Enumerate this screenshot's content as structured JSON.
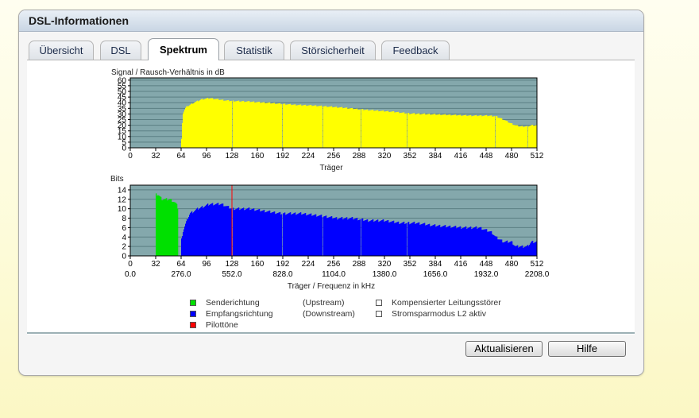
{
  "window": {
    "title": "DSL-Informationen"
  },
  "tabs": [
    {
      "label": "Übersicht"
    },
    {
      "label": "DSL"
    },
    {
      "label": "Spektrum",
      "active": true
    },
    {
      "label": "Statistik"
    },
    {
      "label": "Störsicherheit"
    },
    {
      "label": "Feedback"
    }
  ],
  "colors": {
    "plot_bg": "#84a8ac",
    "snr_fill": "#ffff00",
    "upstream": "#00e000",
    "downstream": "#0000ff",
    "pilot": "#ff0000",
    "gridline": "#5b7f83"
  },
  "chart_data": [
    {
      "type": "bar",
      "title": "Signal / Rausch-Verhältnis in dB",
      "xlabel": "Träger",
      "xlim": [
        0,
        512
      ],
      "ylim": [
        0,
        62
      ],
      "x_ticks": [
        "0",
        "32",
        "64",
        "96",
        "128",
        "160",
        "192",
        "224",
        "256",
        "288",
        "320",
        "352",
        "384",
        "416",
        "448",
        "480",
        "512"
      ],
      "y_ticks": [
        "0",
        "5",
        "10",
        "15",
        "20",
        "25",
        "30",
        "35",
        "40",
        "45",
        "50",
        "55",
        "60"
      ],
      "series": [
        {
          "color": "#ffff00",
          "x": [
            64,
            66,
            70,
            75,
            80,
            90,
            100,
            110,
            120,
            130,
            150,
            170,
            190,
            210,
            230,
            250,
            270,
            290,
            310,
            330,
            350,
            370,
            390,
            410,
            430,
            450,
            460,
            470,
            478,
            485,
            490,
            500,
            505,
            512
          ],
          "values": [
            0,
            30,
            36,
            38,
            40,
            43,
            44,
            43,
            42,
            41.5,
            41,
            40,
            39,
            38,
            37.5,
            36.5,
            35.5,
            34,
            33,
            32,
            30.5,
            30,
            29.5,
            29,
            28.5,
            28.5,
            28,
            25,
            22,
            20,
            19,
            19,
            20,
            20
          ]
        }
      ],
      "gaps": [
        128,
        191,
        242,
        290,
        348,
        459,
        500
      ]
    },
    {
      "type": "bar",
      "ylabel": "Bits",
      "xlabel": "Träger / Frequenz in kHz",
      "xlim": [
        0,
        512
      ],
      "ylim": [
        0,
        15
      ],
      "x_ticks": [
        "0",
        "32",
        "64",
        "96",
        "128",
        "160",
        "192",
        "224",
        "256",
        "288",
        "320",
        "352",
        "384",
        "416",
        "448",
        "480",
        "512"
      ],
      "freq_ticks": [
        "0.0",
        "276.0",
        "552.0",
        "828.0",
        "1104.0",
        "1380.0",
        "1656.0",
        "1932.0",
        "2208.0"
      ],
      "y_ticks": [
        "0",
        "2",
        "4",
        "6",
        "8",
        "10",
        "12",
        "14"
      ],
      "series": [
        {
          "name": "Upstream",
          "color": "#00e000",
          "x": [
            32,
            35,
            40,
            45,
            50,
            55,
            58,
            60
          ],
          "values": [
            13,
            13,
            12,
            12,
            12,
            11.5,
            11,
            10
          ]
        },
        {
          "name": "Downstream",
          "color": "#0000ff",
          "x": [
            64,
            66,
            70,
            75,
            85,
            100,
            115,
            128,
            135,
            150,
            170,
            190,
            215,
            240,
            260,
            280,
            300,
            320,
            340,
            360,
            380,
            420,
            440,
            455,
            460,
            470,
            480,
            485,
            490,
            500,
            505,
            512
          ],
          "values": [
            3,
            5,
            7,
            9,
            10,
            11,
            11,
            10,
            10,
            10,
            9.5,
            9,
            9,
            8.5,
            8,
            8,
            7.5,
            7.5,
            7,
            7,
            6.5,
            6,
            6,
            5,
            4,
            3,
            3,
            2,
            2,
            2,
            3,
            3
          ]
        }
      ],
      "pilot_tones": [
        128
      ],
      "gaps": [
        128,
        191,
        242,
        290,
        348
      ]
    }
  ],
  "legend": {
    "upstream_label": "Senderichtung",
    "upstream_note": "(Upstream)",
    "downstream_label": "Empfangsrichtung",
    "downstream_note": "(Downstream)",
    "pilot_label": "Pilottöne",
    "crosstalk_label": "Kompensierter Leitungsstörer",
    "l2_label": "Stromsparmodus L2 aktiv"
  },
  "buttons": {
    "refresh": "Aktualisieren",
    "help": "Hilfe"
  }
}
